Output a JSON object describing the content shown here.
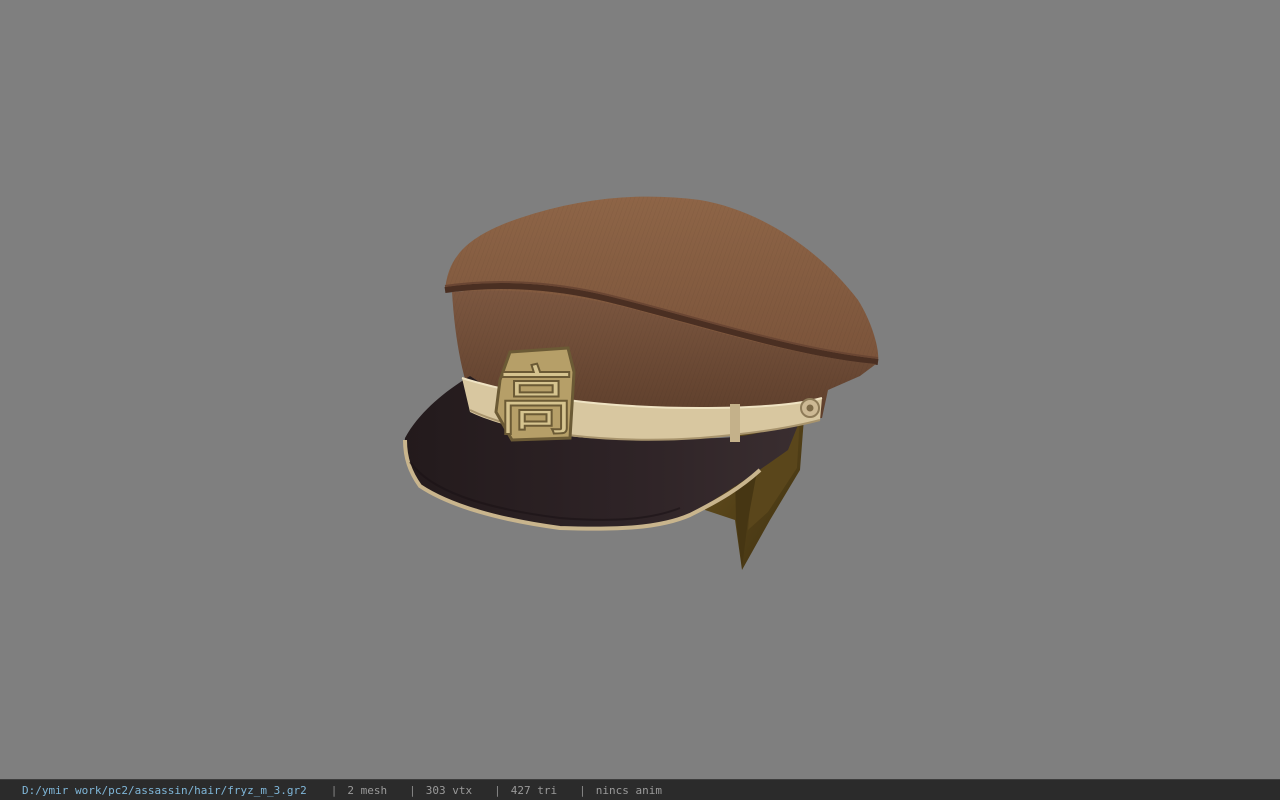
{
  "status": {
    "file_path": "D:/ymir work/pc2/assassin/hair/fryz_m_3.gr2",
    "separator": "|",
    "mesh_count": "2 mesh",
    "vertex_count": "303 vtx",
    "triangle_count": "427 tri",
    "animation": "nincs anim"
  },
  "viewport": {
    "background_color": "#7f7f7f",
    "model_subject": "peaked-cap-with-hair",
    "badge_glyph": "高"
  }
}
